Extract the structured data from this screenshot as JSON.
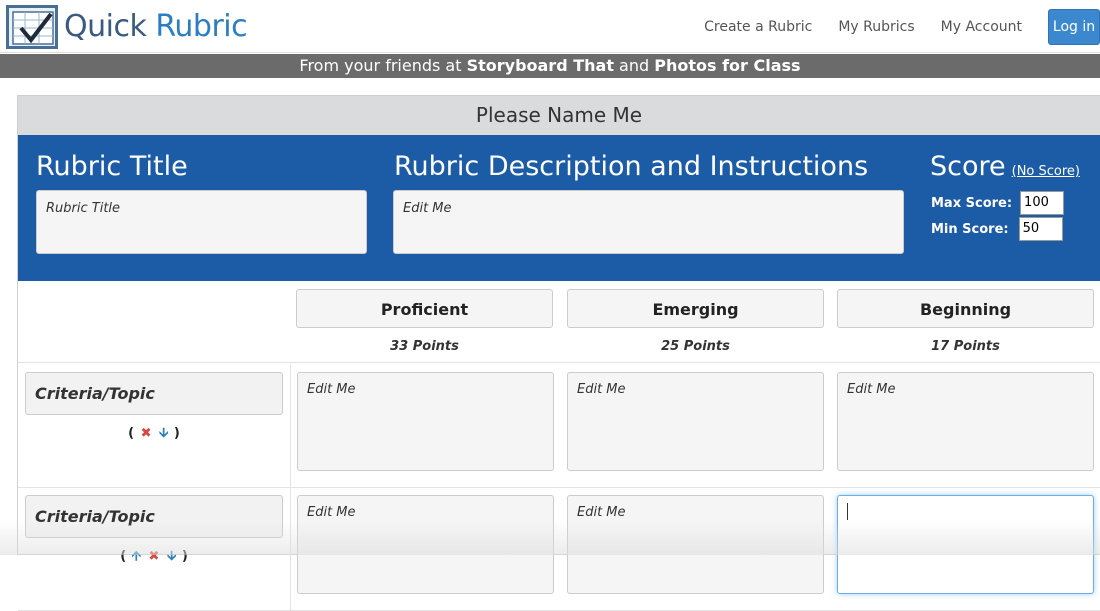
{
  "navbar": {
    "logo_part1": "Quick",
    "logo_part2": "Rubric",
    "links": [
      "Create a Rubric",
      "My Rubrics",
      "My Account"
    ],
    "login_label": "Log in"
  },
  "promo": {
    "prefix": "From your friends at ",
    "brand1": "Storyboard That",
    "middle": " and ",
    "brand2": "Photos for Class"
  },
  "rubric": {
    "name_banner": "Please Name Me",
    "title_label": "Rubric Title",
    "title_value": "Rubric Title",
    "description_label": "Rubric Description and Instructions",
    "description_value": "Edit Me",
    "score_label": "Score",
    "no_score_link": "(No Score)",
    "max_score_label": "Max Score:",
    "max_score_value": "100",
    "min_score_label": "Min Score:",
    "min_score_value": "50"
  },
  "levels": [
    {
      "name": "Proficient",
      "points": "33 Points"
    },
    {
      "name": "Emerging",
      "points": "25 Points"
    },
    {
      "name": "Beginning",
      "points": "17 Points"
    }
  ],
  "rows": [
    {
      "criteria": "Criteria/Topic",
      "controls": [
        "(",
        "x-icon",
        "down-arrow-icon",
        ")"
      ],
      "cells": [
        "Edit Me",
        "Edit Me",
        "Edit Me"
      ]
    },
    {
      "criteria": "Criteria/Topic",
      "controls": [
        "(",
        "up-arrow-icon",
        "x-icon",
        "down-arrow-icon",
        ")"
      ],
      "cells": [
        "Edit Me",
        "Edit Me",
        ""
      ]
    }
  ],
  "colors": {
    "panel_blue": "#1c5ca7",
    "login_blue": "#3b88cf",
    "promo_gray": "#6b6b6b",
    "remove_red": "#d9463e",
    "arrow_blue": "#2b7fc1"
  }
}
